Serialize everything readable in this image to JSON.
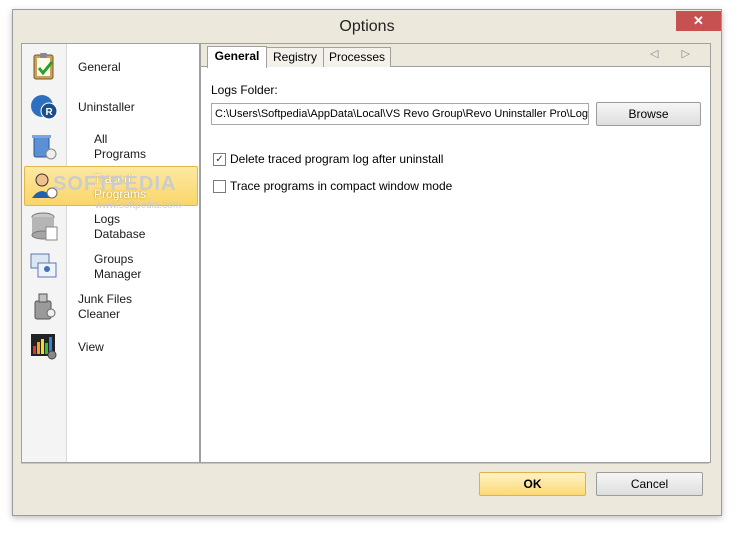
{
  "window": {
    "title": "Options",
    "close_symbol": "✕"
  },
  "sidebar": {
    "items": [
      {
        "label": "General",
        "icon": "clipboard-check-icon"
      },
      {
        "label": "Uninstaller",
        "icon": "revo-uninstaller-icon"
      },
      {
        "label": "All\nPrograms",
        "icon": "programs-trash-icon"
      },
      {
        "label": "Traced\nPrograms",
        "icon": "user-traced-icon"
      },
      {
        "label": "Logs\nDatabase",
        "icon": "database-icon"
      },
      {
        "label": "Groups\nManager",
        "icon": "groups-windows-icon"
      },
      {
        "label": "Junk Files\nCleaner",
        "icon": "junk-cleaner-icon"
      },
      {
        "label": "View",
        "icon": "view-color-icon"
      }
    ],
    "selected": "Traced\nPrograms"
  },
  "tabs": [
    {
      "label": "General",
      "active": true
    },
    {
      "label": "Registry",
      "active": false
    },
    {
      "label": "Processes",
      "active": false
    }
  ],
  "tab_arrows": "◁ ▷",
  "general": {
    "logs_folder_label": "Logs Folder:",
    "logs_folder_value": "C:\\Users\\Softpedia\\AppData\\Local\\VS Revo Group\\Revo Uninstaller Pro\\Logs",
    "browse_label": "Browse",
    "options": [
      {
        "label": "Delete traced program log after uninstall",
        "checked": true
      },
      {
        "label": "Trace programs in compact window mode",
        "checked": false
      }
    ]
  },
  "watermark": {
    "main": "SOFTPEDIA",
    "sub": "www.softpedia.com"
  },
  "footer": {
    "ok_label": "OK",
    "cancel_label": "Cancel"
  },
  "colors": {
    "selected_bg": "#fad56a",
    "close_red": "#c75050",
    "ok_bg": "#fbd975"
  }
}
